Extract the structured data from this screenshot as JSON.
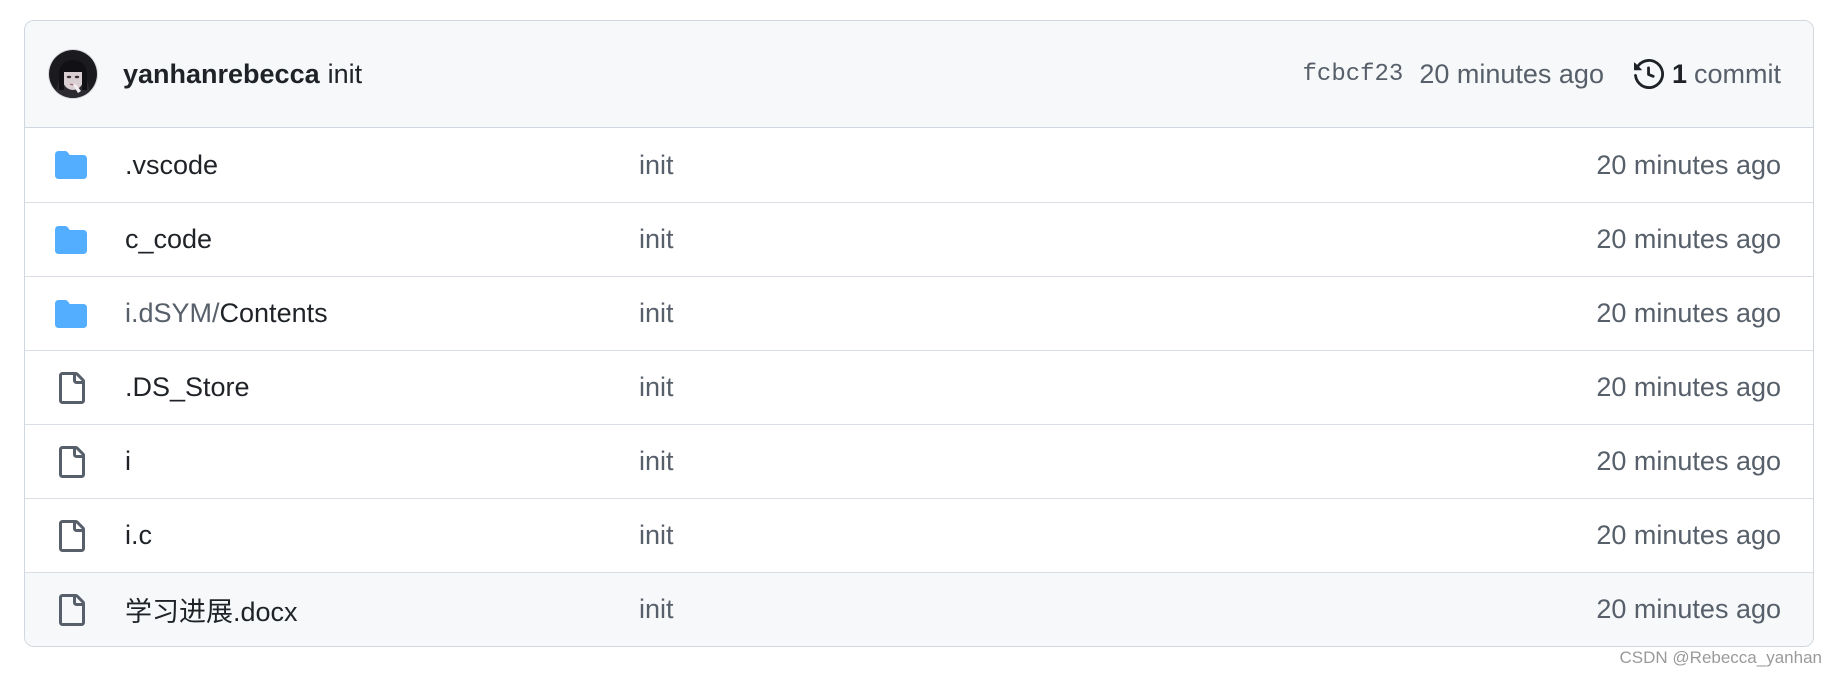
{
  "commit_header": {
    "avatar_icon": "user-avatar",
    "author": "yanhanrebecca",
    "message": "init",
    "sha": "fcbcf23",
    "time": "20 minutes ago",
    "history_icon": "history-icon",
    "count": "1",
    "count_label": "commit"
  },
  "colors": {
    "folder": "#54aeff",
    "file_icon": "#57606a",
    "muted_text": "#57606a",
    "border": "#d0d7de",
    "header_bg": "#f6f8fa"
  },
  "files": [
    {
      "type": "folder",
      "icon": "folder-icon",
      "name_prefix": "",
      "name": ".vscode",
      "message": "init",
      "time": "20 minutes ago"
    },
    {
      "type": "folder",
      "icon": "folder-icon",
      "name_prefix": "",
      "name": "c_code",
      "message": "init",
      "time": "20 minutes ago"
    },
    {
      "type": "folder",
      "icon": "folder-icon",
      "name_prefix": "i.dSYM/",
      "name": "Contents",
      "message": "init",
      "time": "20 minutes ago"
    },
    {
      "type": "file",
      "icon": "file-icon",
      "name_prefix": "",
      "name": ".DS_Store",
      "message": "init",
      "time": "20 minutes ago"
    },
    {
      "type": "file",
      "icon": "file-icon",
      "name_prefix": "",
      "name": "i",
      "message": "init",
      "time": "20 minutes ago"
    },
    {
      "type": "file",
      "icon": "file-icon",
      "name_prefix": "",
      "name": "i.c",
      "message": "init",
      "time": "20 minutes ago"
    },
    {
      "type": "file",
      "icon": "file-icon",
      "name_prefix": "",
      "name": "学习进展.docx",
      "message": "init",
      "time": "20 minutes ago"
    }
  ],
  "watermark": "CSDN @Rebecca_yanhan"
}
